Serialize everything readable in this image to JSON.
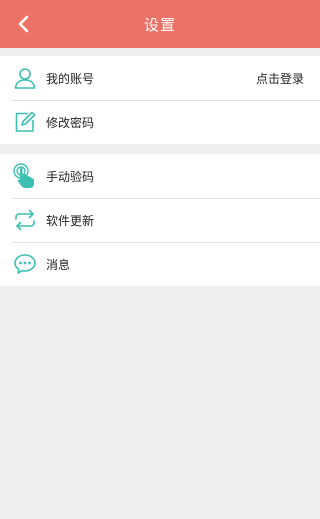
{
  "header": {
    "title": "设置",
    "back_icon": "chevron-left-icon"
  },
  "groups": [
    {
      "items": [
        {
          "icon": "user-icon",
          "label": "我的账号",
          "right_text": "点击登录"
        },
        {
          "icon": "edit-icon",
          "label": "修改密码"
        }
      ]
    },
    {
      "items": [
        {
          "icon": "tap-hand-icon",
          "label": "手动验码"
        },
        {
          "icon": "refresh-arrows-icon",
          "label": "软件更新"
        },
        {
          "icon": "chat-bubble-icon",
          "label": "消息"
        }
      ]
    }
  ],
  "colors": {
    "header_bg": "#ec7268",
    "icon_teal": "#3dbfb1",
    "page_bg": "#efefef"
  }
}
